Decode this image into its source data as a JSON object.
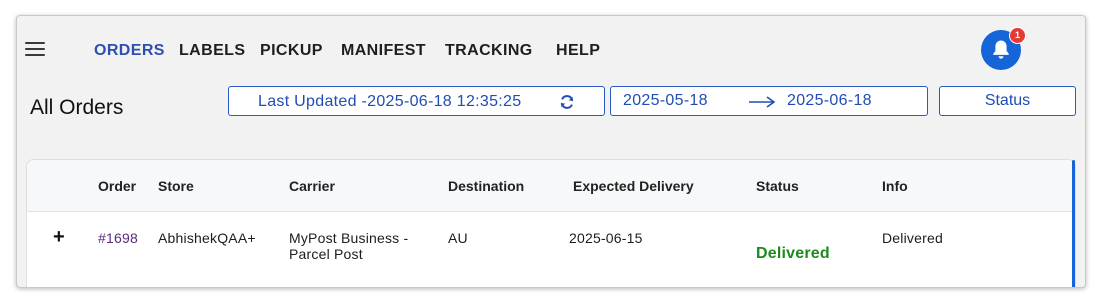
{
  "nav": {
    "items": [
      "ORDERS",
      "LABELS",
      "PICKUP",
      "MANIFEST",
      "TRACKING",
      "HELP"
    ],
    "active": "ORDERS"
  },
  "notifications": {
    "count": "1"
  },
  "page": {
    "title": "All Orders",
    "last_updated": "Last Updated -2025-06-18 12:35:25",
    "date_from": "2025-05-18",
    "date_to": "2025-06-18",
    "status_filter": "Status"
  },
  "table": {
    "columns": [
      "Order",
      "Store",
      "Carrier",
      "Destination",
      "Expected Delivery",
      "Status",
      "Info"
    ],
    "rows": [
      {
        "expand": "+",
        "order": "#1698",
        "store": "AbhishekQAA+",
        "carrier_line1": "MyPost Business -",
        "carrier_line2": "Parcel Post",
        "destination": "AU",
        "expected_delivery": "2025-06-15",
        "status": "Delivered",
        "info": "Delivered"
      }
    ]
  },
  "colors": {
    "accent": "#2b59c3",
    "nav_active": "#2e4fb0",
    "bell": "#1565d8",
    "badge": "#e53935",
    "status_delivered": "#1e8a1e",
    "order_link": "#5a2b7a"
  },
  "icons": [
    "menu-icon",
    "bell-icon",
    "refresh-icon",
    "arrow-right-icon",
    "plus-icon"
  ]
}
